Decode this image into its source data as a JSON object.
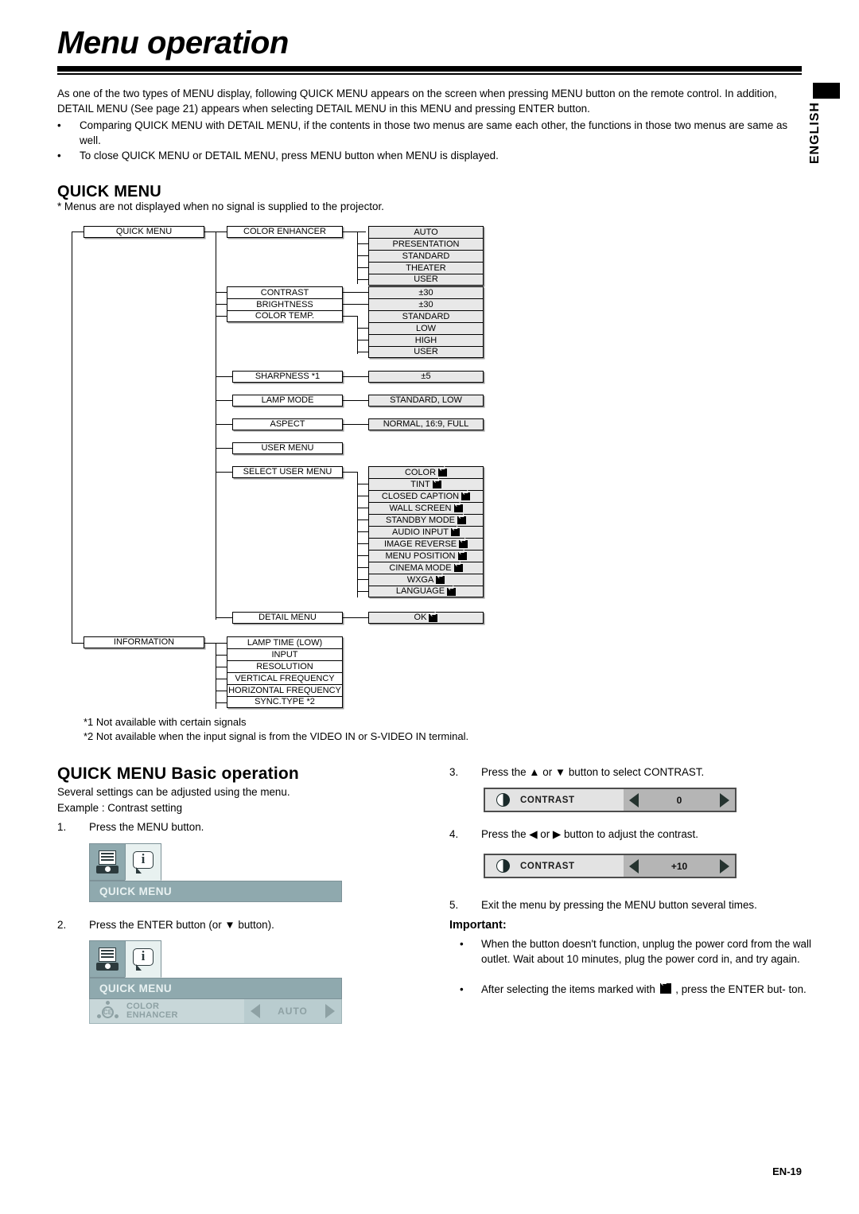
{
  "page": {
    "title": "Menu operation",
    "language_tab": "ENGLISH",
    "footer": "EN-19"
  },
  "intro": {
    "paragraph": "As one of the two types of MENU display, following QUICK MENU appears on the screen when pressing MENU button on the remote control. In addition, DETAIL MENU (See page 21) appears when selecting DETAIL MENU in this MENU and pressing ENTER button.",
    "bullets": [
      "Comparing QUICK MENU with DETAIL MENU, if the contents in those two menus are same each other, the functions in those two menus are same as well.",
      "To close QUICK MENU or DETAIL MENU, press MENU button when MENU is displayed."
    ],
    "bullet_mark": "•"
  },
  "quick_menu_section": {
    "heading": "QUICK MENU",
    "note": "* Menus are not displayed when no signal is supplied to the projector."
  },
  "tree": {
    "root": "QUICK MENU",
    "level2": {
      "color_enhancer": "COLOR ENHANCER",
      "contrast": "CONTRAST",
      "brightness": "BRIGHTNESS",
      "color_temp": "COLOR TEMP.",
      "sharpness": "SHARPNESS *1",
      "lamp_mode": "LAMP MODE",
      "aspect": "ASPECT",
      "user_menu": "USER MENU",
      "select_user_menu": "SELECT USER MENU",
      "detail_menu": "DETAIL MENU",
      "information": "INFORMATION"
    },
    "color_enhancer_values": [
      "AUTO",
      "PRESENTATION",
      "STANDARD",
      "THEATER",
      "USER"
    ],
    "contrast_value": "±30",
    "brightness_value": "±30",
    "color_temp_values": [
      "STANDARD",
      "LOW",
      "HIGH",
      "USER"
    ],
    "sharpness_value": "±5",
    "lamp_mode_value": "STANDARD, LOW",
    "aspect_value": "NORMAL, 16:9, FULL",
    "select_user_menu_values": [
      "COLOR",
      "TINT",
      "CLOSED CAPTION",
      "WALL SCREEN",
      "STANDBY MODE",
      "AUDIO INPUT",
      "IMAGE REVERSE",
      "MENU POSITION",
      "CINEMA MODE",
      "WXGA",
      "LANGUAGE"
    ],
    "detail_menu_value": "OK",
    "information_values": [
      "LAMP TIME (LOW)",
      "INPUT",
      "RESOLUTION",
      "VERTICAL FREQUENCY",
      "HORIZONTAL FREQUENCY",
      "SYNC.TYPE *2"
    ],
    "enter_icon": "enter-key-icon"
  },
  "footnotes": {
    "fn1": "*1 Not available with certain signals",
    "fn2": "*2 Not available when the input signal is from the VIDEO IN or S-VIDEO IN terminal."
  },
  "basic_operation": {
    "heading": "QUICK MENU Basic operation",
    "intro1": "Several settings can be adjusted using the menu.",
    "intro2": "Example : Contrast setting",
    "steps": [
      {
        "num": "1.",
        "text": "Press the MENU button."
      },
      {
        "num": "2.",
        "text": "Press the ENTER button (or ▼ button)."
      },
      {
        "num": "3.",
        "text": "Press the ▲ or ▼ button to select CONTRAST."
      },
      {
        "num": "4.",
        "text": "Press the ◀ or ▶ button to adjust the contrast."
      },
      {
        "num": "5.",
        "text": "Exit the menu by pressing the MENU button several times."
      }
    ]
  },
  "osd1": {
    "tab_projector": "projector-icon",
    "tab_info": "info-icon",
    "title": "QUICK MENU"
  },
  "osd2": {
    "tab_projector": "projector-icon",
    "tab_info": "info-icon",
    "title": "QUICK MENU",
    "row_icon": "color-enhancer-icon",
    "row_label_line1": "COLOR",
    "row_label_line2": "ENHANCER",
    "row_value": "AUTO",
    "left_arrow": "◀",
    "right_arrow": "▶"
  },
  "contrast_bar_before": {
    "icon": "contrast-icon",
    "label": "CONTRAST",
    "value": "0",
    "left_arrow": "◀",
    "right_arrow": "▶"
  },
  "contrast_bar_after": {
    "icon": "contrast-icon",
    "label": "CONTRAST",
    "value": "+10",
    "left_arrow": "◀",
    "right_arrow": "▶"
  },
  "important": {
    "title": "Important:",
    "bullet_mark": "•",
    "items": [
      "When the button doesn't function, unplug the power cord from the wall outlet. Wait about 10 minutes, plug the power cord in, and try again.",
      "After selecting the items marked with ⏎ , press the ENTER but-ton."
    ],
    "item2_pre": "After selecting the items marked with",
    "item2_post": ", press the ENTER but-",
    "item2_tail": "ton."
  },
  "colors": {
    "osd_title_bg": "#8fa9ae",
    "osd_row_bg": "#c8d7d9",
    "osd_value_bg": "#b9cccf",
    "tree_value_fill": "#e8e8e8",
    "bar_value_bg": "#b5b5b5"
  }
}
